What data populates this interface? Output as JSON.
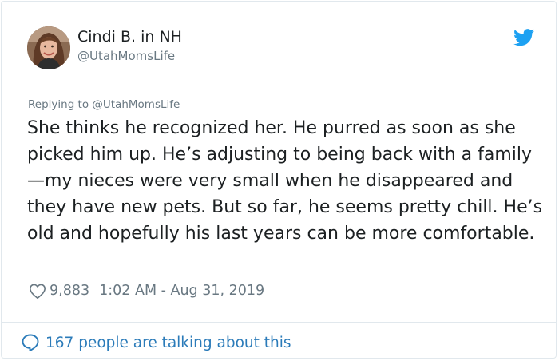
{
  "tweet": {
    "author_name": "Cindi B. in NH",
    "author_handle": "@UtahMomsLife",
    "replying_to": "Replying to @UtahMomsLife",
    "text": "She thinks he recognized her. He purred as soon as she picked him up. He’s adjusting to being back with a family—my nieces were very small when he disappeared and they have new pets. But so far, he seems pretty chill. He’s old and hopefully his last years can be more comfortable.",
    "like_count": "9,883",
    "timestamp": "1:02 AM - Aug 31, 2019",
    "conversation_link": "167 people are talking about this"
  },
  "icons": {
    "brand": "twitter-bird-icon",
    "like": "heart-icon",
    "conversation": "speech-bubble-icon"
  },
  "colors": {
    "brand_blue": "#1da1f2",
    "link_blue": "#2b7bb9",
    "secondary_text": "#697882",
    "border": "#e1e8ed"
  }
}
